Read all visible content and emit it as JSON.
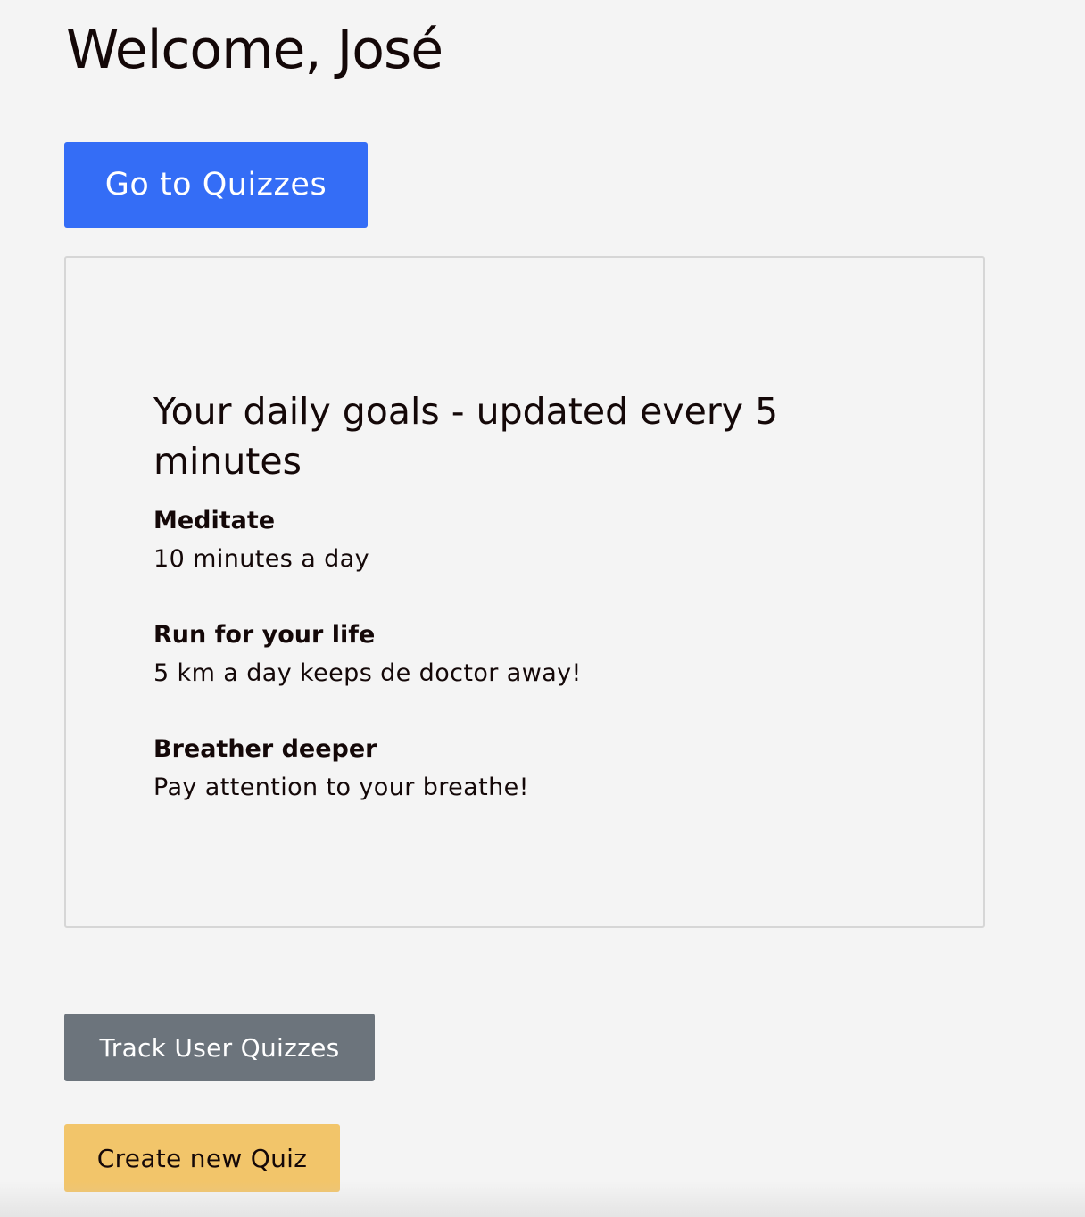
{
  "header": {
    "title": "Welcome, José"
  },
  "actions": {
    "go_to_quizzes_label": "Go to Quizzes",
    "track_user_quizzes_label": "Track User Quizzes",
    "create_new_quiz_label": "Create new Quiz"
  },
  "goals": {
    "heading": "Your daily goals - updated every 5 minutes",
    "items": [
      {
        "name": "Meditate",
        "description": "10 minutes a day"
      },
      {
        "name": "Run for your life",
        "description": "5 km a day keeps de doctor away!"
      },
      {
        "name": "Breather deeper",
        "description": "Pay attention to your breathe!"
      }
    ]
  },
  "colors": {
    "background": "#f4f4f4",
    "primary": "#346df6",
    "secondary": "#6c747c",
    "warning": "#f2c56a",
    "text": "#140808"
  }
}
